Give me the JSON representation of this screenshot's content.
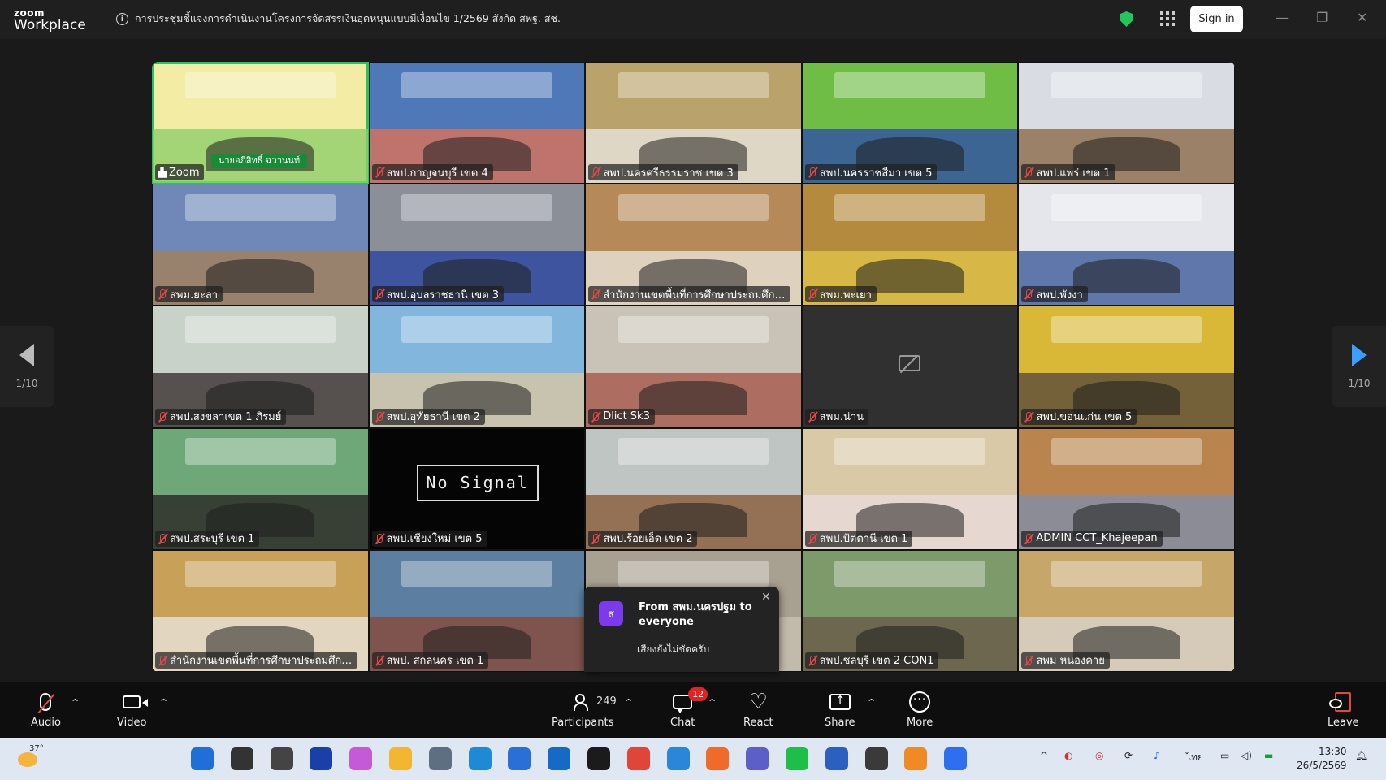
{
  "titlebar": {
    "brand_top": "zoom",
    "brand_bottom": "Workplace",
    "meeting_title": "การประชุมชี้แจงการดำเนินงานโครงการจัดสรรเงินอุดหนุนแบบมีเงื่อนไข 1/2569 สังกัด สพฐ. สช.",
    "sign_in": "Sign in",
    "minimize": "—",
    "restore": "❐",
    "close": "✕"
  },
  "gallery": {
    "page_label": "1/10",
    "speaker_caption": "นายอภิสิทธิ์ ฉวานนท์",
    "no_signal_text": "No Signal",
    "tiles": [
      {
        "name": "Zoom",
        "bg": "#f3eca5",
        "fg": "#8fd06a",
        "muted": false
      },
      {
        "name": "สพป.กาญจนบุรี เขต 4",
        "bg": "#4f78b8",
        "fg": "#d9735a",
        "muted": true
      },
      {
        "name": "สพป.นครศรีธรรมราช เขต 3",
        "bg": "#b9a36a",
        "fg": "#e9e4dc",
        "muted": true
      },
      {
        "name": "สพป.นครราชสีมา เขต 5",
        "bg": "#6fbd45",
        "fg": "#2f4fa8",
        "muted": true
      },
      {
        "name": "สพป.แพร่ เขต 1",
        "bg": "#d9dde3",
        "fg": "#8b6a48",
        "muted": true
      },
      {
        "name": "สพม.ยะลา",
        "bg": "#6f88b8",
        "fg": "#a2805a",
        "muted": true
      },
      {
        "name": "สพป.อุบลราชธานี เขต 3",
        "bg": "#8a8f98",
        "fg": "#2a45a0",
        "muted": true
      },
      {
        "name": "สำนักงานเขตพื้นที่การศึกษาประถมศึกษา ฉ...",
        "bg": "#b68a58",
        "fg": "#e8e2d8",
        "muted": true
      },
      {
        "name": "สพม.พะเยา",
        "bg": "#b48a3c",
        "fg": "#e0c34a",
        "muted": true
      },
      {
        "name": "สพป.พังงา",
        "bg": "#e4e6ec",
        "fg": "#3e5b9c",
        "muted": true
      },
      {
        "name": "สพป.สงขลาเขต 1 ภิรมย์",
        "bg": "#c8d2c8",
        "fg": "#3a3030",
        "muted": true
      },
      {
        "name": "สพป.อุทัยธานี เขต 2",
        "bg": "#82b6dd",
        "fg": "#d8c7a2",
        "muted": true
      },
      {
        "name": "Dlict Sk3",
        "bg": "#c9c2b6",
        "fg": "#a6584c",
        "muted": true
      },
      {
        "name": "สพม.น่าน",
        "bg": "#303030",
        "fg": "#303030",
        "muted": true,
        "camera_off": true
      },
      {
        "name": "สพป.ขอนแก่น เขต 5",
        "bg": "#d9b838",
        "fg": "#5a4a3a",
        "muted": true
      },
      {
        "name": "สพป.สระบุรี เขต 1",
        "bg": "#6ea878",
        "fg": "#2b2625",
        "muted": true
      },
      {
        "name": "สพป.เชียงใหม่ เขต 5",
        "bg": "#050505",
        "fg": "#050505",
        "muted": true,
        "no_signal": true
      },
      {
        "name": "สพป.ร้อยเอ็ด เขต 2",
        "bg": "#bfc5c2",
        "fg": "#8a5a3a",
        "muted": true
      },
      {
        "name": "สพป.ปัตตานี เขต 1",
        "bg": "#d9c9a6",
        "fg": "#e9dcdc",
        "muted": true
      },
      {
        "name": "ADMIN CCT_Khajeepan",
        "bg": "#b9844e",
        "fg": "#7f8fa8",
        "muted": true
      },
      {
        "name": "สำนักงานเขตพื้นที่การศึกษาประถมศึกษา ป...",
        "bg": "#c8a058",
        "fg": "#e8e4dc",
        "muted": true
      },
      {
        "name": "สพป. สกลนคร เขต 1",
        "bg": "#5c7ea0",
        "fg": "#8a4a3a",
        "muted": true
      },
      {
        "name": "",
        "bg": "#a8a090",
        "fg": "#c8c0b0",
        "muted": false,
        "hidden_label": true
      },
      {
        "name": "สพป.ชลบุรี เขต 2 CON1",
        "bg": "#7c9a6a",
        "fg": "#6a5a48",
        "muted": true
      },
      {
        "name": "สพม หนองคาย",
        "bg": "#c7a66a",
        "fg": "#d8d4cc",
        "muted": true
      }
    ]
  },
  "chat_popup": {
    "avatar_letter": "ส",
    "from_text": "From สพม.นครปฐม to everyone",
    "message": "เสียงยังไม่ชัดครับ"
  },
  "toolbar": {
    "audio": "Audio",
    "video": "Video",
    "participants": "Participants",
    "participants_count": "249",
    "chat": "Chat",
    "chat_badge": "12",
    "react": "React",
    "share": "Share",
    "more": "More",
    "leave": "Leave",
    "caret": "^"
  },
  "taskbar": {
    "temperature": "37°",
    "language": "ไทย",
    "time": "13:30",
    "date": "26/5/2569",
    "apps": [
      {
        "name": "start",
        "color": "#1f6fd6"
      },
      {
        "name": "search",
        "color": "#333333"
      },
      {
        "name": "task-view",
        "color": "#444444"
      },
      {
        "name": "app-w",
        "color": "#1b3fa8"
      },
      {
        "name": "copilot",
        "color": "#c45ad8"
      },
      {
        "name": "file-explorer",
        "color": "#f2b632"
      },
      {
        "name": "settings",
        "color": "#5f6f82"
      },
      {
        "name": "edge",
        "color": "#1e8ad6"
      },
      {
        "name": "store",
        "color": "#2a6fd8"
      },
      {
        "name": "outlook",
        "color": "#1669c5"
      },
      {
        "name": "dropbox",
        "color": "#1b1b1b"
      },
      {
        "name": "chrome",
        "color": "#e0453a"
      },
      {
        "name": "clock-app",
        "color": "#2a86d8"
      },
      {
        "name": "firefox",
        "color": "#f06a2a"
      },
      {
        "name": "teams",
        "color": "#5b5fc7"
      },
      {
        "name": "line",
        "color": "#1fbd4a"
      },
      {
        "name": "word",
        "color": "#2b5fc0"
      },
      {
        "name": "app-red",
        "color": "#3a3a3a"
      },
      {
        "name": "app-orange",
        "color": "#f08a24"
      },
      {
        "name": "zoom",
        "color": "#2d6ff0"
      }
    ]
  }
}
